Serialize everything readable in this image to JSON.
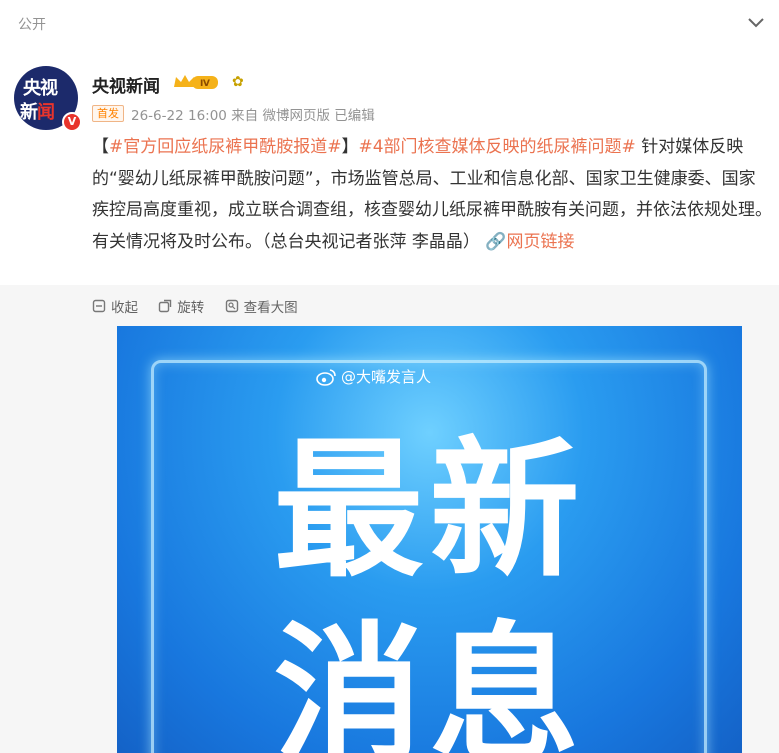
{
  "header": {
    "visibility": "公开"
  },
  "post": {
    "author": "央视新闻",
    "level_badge": "Ⅳ",
    "first_badge": "首发",
    "meta": "26-6-22 16:00  来自 微博网页版 已编辑",
    "avatar": {
      "line1": "央视",
      "line2a": "新",
      "line2b": "闻"
    },
    "content": {
      "bracket_open": "【",
      "tag1": "#官方回应纸尿裤甲酰胺报道#",
      "bracket_close": "】",
      "tag2": "#4部门核查媒体反映的纸尿裤问题#",
      "body": " 针对媒体反映的“婴幼儿纸尿裤甲酰胺问题”，市场监管总局、工业和信息化部、国家卫生健康委、国家疾控局高度重视，成立联合调查组，核查婴幼儿纸尿裤甲酰胺有关问题，并依法依规处理。有关情况将及时公布。（总台央视记者张萍 李晶晶）",
      "link_text": "网页链接"
    }
  },
  "media_tools": {
    "collapse": "收起",
    "rotate": "旋转",
    "view_large": "查看大图"
  },
  "image": {
    "watermark": "@大嘴发言人",
    "line1": "最新",
    "line2": "消息"
  },
  "colors": {
    "link": "#eb7350",
    "accent_orange": "#ff8200",
    "image_blue": "#1877de"
  }
}
